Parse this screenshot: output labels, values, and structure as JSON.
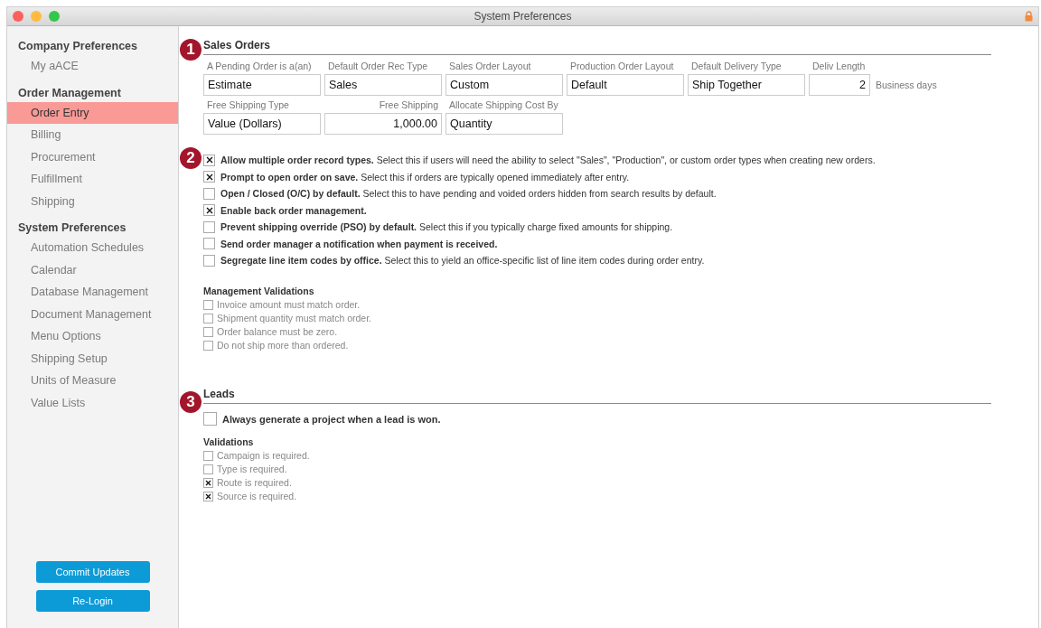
{
  "window": {
    "title": "System Preferences"
  },
  "sidebar": {
    "groups": [
      {
        "heading": "Company Preferences",
        "items": [
          {
            "label": "My aACE",
            "selected": false
          }
        ]
      },
      {
        "heading": "Order Management",
        "items": [
          {
            "label": "Order Entry",
            "selected": true
          },
          {
            "label": "Billing",
            "selected": false
          },
          {
            "label": "Procurement",
            "selected": false
          },
          {
            "label": "Fulfillment",
            "selected": false
          },
          {
            "label": "Shipping",
            "selected": false
          }
        ]
      },
      {
        "heading": "System Preferences",
        "items": [
          {
            "label": "Automation Schedules",
            "selected": false
          },
          {
            "label": "Calendar",
            "selected": false
          },
          {
            "label": "Database Management",
            "selected": false
          },
          {
            "label": "Document Management",
            "selected": false
          },
          {
            "label": "Menu Options",
            "selected": false
          },
          {
            "label": "Shipping Setup",
            "selected": false
          },
          {
            "label": "Units of Measure",
            "selected": false
          },
          {
            "label": "Value Lists",
            "selected": false
          }
        ]
      }
    ],
    "buttons": [
      "Commit Updates",
      "Re-Login"
    ]
  },
  "sales_orders": {
    "badge": "1",
    "title": "Sales Orders",
    "field_rows": [
      [
        {
          "label": "A Pending Order is a(an)",
          "value": "Estimate",
          "kind": "text"
        },
        {
          "label": "Default Order Rec Type",
          "value": "Sales",
          "kind": "text"
        },
        {
          "label": "Sales Order Layout",
          "value": "Custom",
          "kind": "text"
        },
        {
          "label": "Production Order Layout",
          "value": "Default",
          "kind": "text"
        },
        {
          "label": "Default Delivery Type",
          "value": "Ship Together",
          "kind": "text"
        },
        {
          "label": "Deliv Length",
          "value": "2",
          "kind": "count",
          "unit": "Business days"
        }
      ],
      [
        {
          "label": "Free Shipping Type",
          "value": "Value (Dollars)",
          "kind": "text"
        },
        {
          "label": "Free Shipping",
          "value": "1,000.00",
          "kind": "amount"
        },
        {
          "label": "Allocate Shipping Cost By",
          "value": "Quantity",
          "kind": "text"
        }
      ]
    ]
  },
  "options": {
    "badge": "2",
    "items": [
      {
        "text": "**Allow multiple order record types.** Select this if users will need the ability to select \"Sales\", \"Production\", or custom order types when creating new orders.",
        "checked": true
      },
      {
        "text": "**Prompt to open order on save.** Select this if orders are typically opened immediately after entry.",
        "checked": true
      },
      {
        "text": "**Open / Closed (O/C) by default.** Select this to have pending and voided orders hidden from search results by default.",
        "checked": false
      },
      {
        "text": "**Enable back order management.**",
        "checked": true
      },
      {
        "text": "**Prevent shipping override (PSO) by default.** Select this if you typically charge fixed amounts for shipping.",
        "checked": false
      },
      {
        "text": "**Send order manager a notification when payment is received.**",
        "checked": false
      },
      {
        "text": "**Segregate line item codes by office.** Select this to yield an office-specific list of line item codes during order entry.",
        "checked": false
      }
    ]
  },
  "management_validations": {
    "title": "Management Validations",
    "items": [
      {
        "label": "Invoice amount must match order.",
        "checked": false
      },
      {
        "label": "Shipment quantity must match order.",
        "checked": false
      },
      {
        "label": "Order balance must be zero.",
        "checked": false
      },
      {
        "label": "Do not ship more than ordered.",
        "checked": false
      }
    ]
  },
  "leads": {
    "badge": "3",
    "title": "Leads",
    "option": {
      "label": "Always generate a project when a lead is won.",
      "checked": false
    },
    "validations_title": "Validations",
    "validations": [
      {
        "label": "Campaign is required.",
        "checked": false
      },
      {
        "label": "Type is required.",
        "checked": false
      },
      {
        "label": "Route is required.",
        "checked": true
      },
      {
        "label": "Source is required.",
        "checked": true
      }
    ]
  }
}
